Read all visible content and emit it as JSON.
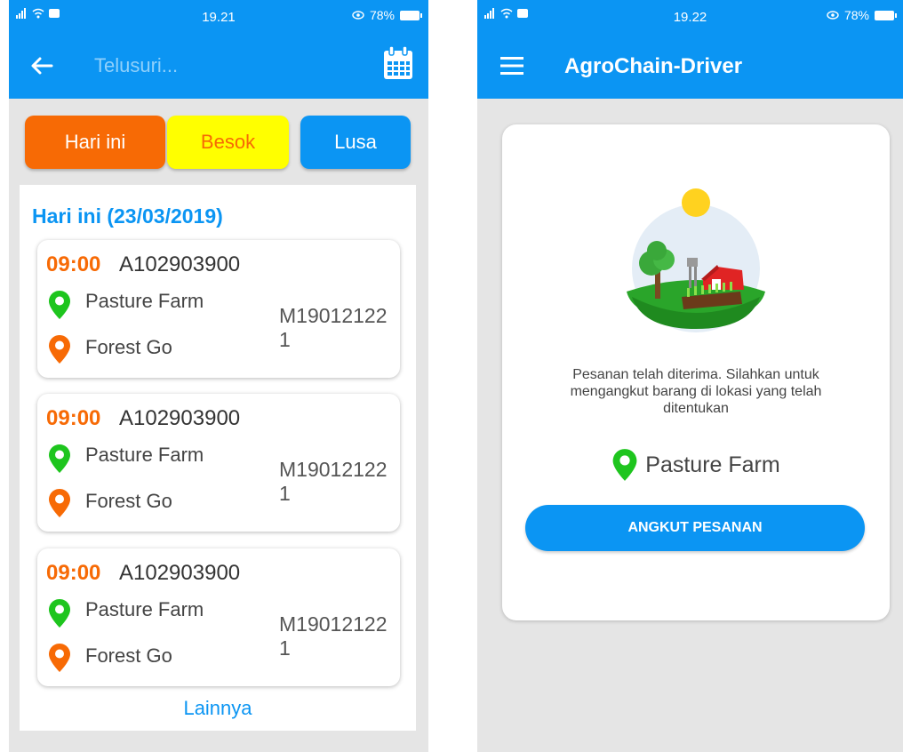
{
  "colors": {
    "primary": "#0b95f3",
    "accent_orange": "#f76a05",
    "accent_yellow": "#ffff00",
    "pin_green": "#1ec51e"
  },
  "left_screen": {
    "status": {
      "time": "19.21",
      "battery": "78%"
    },
    "search": {
      "placeholder": "Telusuri..."
    },
    "filters": {
      "today": "Hari ini",
      "tomorrow": "Besok",
      "after_tomorrow": "Lusa"
    },
    "list_title": "Hari ini (23/03/2019)",
    "orders": [
      {
        "time": "09:00",
        "code": "A102903900",
        "origin": "Pasture Farm",
        "destination": "Forest Go",
        "manifest": "M190121221"
      },
      {
        "time": "09:00",
        "code": "A102903900",
        "origin": "Pasture Farm",
        "destination": "Forest Go",
        "manifest": "M190121221"
      },
      {
        "time": "09:00",
        "code": "A102903900",
        "origin": "Pasture Farm",
        "destination": "Forest Go",
        "manifest": "M190121221"
      }
    ],
    "more_label": "Lainnya",
    "icons": {
      "back": "back-arrow-icon",
      "calendar": "calendar-icon",
      "origin_pin": "location-pin-green-icon",
      "destination_pin": "location-pin-orange-icon"
    }
  },
  "right_screen": {
    "status": {
      "time": "19.22",
      "battery": "78%"
    },
    "app_title": "AgroChain-Driver",
    "message": "Pesanan telah diterima. Silahkan untuk mengangkut barang di lokasi yang telah ditentukan",
    "location": "Pasture Farm",
    "action_button": "ANGKUT PESANAN",
    "icons": {
      "menu": "hamburger-menu-icon",
      "illustration": "farm-illustration",
      "location_pin": "location-pin-green-icon"
    }
  }
}
